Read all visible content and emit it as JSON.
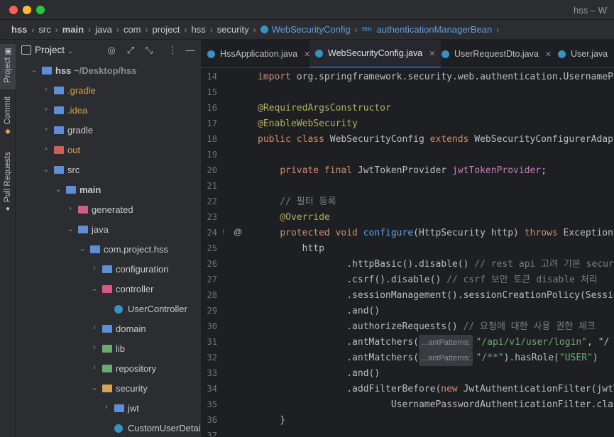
{
  "window": {
    "title": "hss – W"
  },
  "navbar": {
    "crumbs": [
      "hss",
      "src",
      "main",
      "java",
      "com",
      "project",
      "hss",
      "security"
    ],
    "class_crumb": "WebSecurityConfig",
    "method_crumb": "authenticationManagerBean"
  },
  "strip": {
    "project": "Project",
    "commit": "Commit",
    "pull_requests": "Pull Requests"
  },
  "panel": {
    "title": "Project"
  },
  "tree": [
    {
      "label": "hss",
      "sub": "~/Desktop/hss",
      "level": 0,
      "expanded": true,
      "bold": true,
      "icon": "folder-blue"
    },
    {
      "label": ".gradle",
      "level": 1,
      "expanded": false,
      "color": "orange",
      "icon": "folder-gradle"
    },
    {
      "label": ".idea",
      "level": 1,
      "expanded": false,
      "color": "orange",
      "icon": "folder-idea"
    },
    {
      "label": "gradle",
      "level": 1,
      "expanded": false,
      "icon": "folder-gradle"
    },
    {
      "label": "out",
      "level": 1,
      "expanded": false,
      "color": "orange",
      "icon": "folder-red"
    },
    {
      "label": "src",
      "level": 1,
      "expanded": true,
      "icon": "folder-src"
    },
    {
      "label": "main",
      "level": 2,
      "expanded": true,
      "bold": true,
      "icon": "folder-main"
    },
    {
      "label": "generated",
      "level": 3,
      "expanded": false,
      "icon": "folder-generated"
    },
    {
      "label": "java",
      "level": 3,
      "expanded": true,
      "icon": "folder-blue"
    },
    {
      "label": "com.project.hss",
      "level": 4,
      "expanded": true,
      "icon": "folder-package"
    },
    {
      "label": "configuration",
      "level": 5,
      "expanded": false,
      "icon": "folder-package"
    },
    {
      "label": "controller",
      "level": 5,
      "expanded": true,
      "icon": "folder-controller"
    },
    {
      "label": "UserController",
      "level": 6,
      "leaf": true,
      "icon": "class-icon"
    },
    {
      "label": "domain",
      "level": 5,
      "expanded": false,
      "icon": "folder-package"
    },
    {
      "label": "lib",
      "level": 5,
      "expanded": false,
      "icon": "folder-lib"
    },
    {
      "label": "repository",
      "level": 5,
      "expanded": false,
      "icon": "folder-repo"
    },
    {
      "label": "security",
      "level": 5,
      "expanded": true,
      "icon": "folder-security"
    },
    {
      "label": "jwt",
      "level": 6,
      "expanded": false,
      "icon": "folder-package"
    },
    {
      "label": "CustomUserDetailS",
      "level": 6,
      "leaf": true,
      "icon": "class-icon"
    }
  ],
  "tabs": [
    {
      "label": "HssApplication.java",
      "active": false
    },
    {
      "label": "WebSecurityConfig.java",
      "active": true
    },
    {
      "label": "UserRequestDto.java",
      "active": false
    },
    {
      "label": "User.java",
      "active": false
    }
  ],
  "editor": {
    "lines": [
      {
        "n": "14",
        "tokens": [
          [
            "kw",
            "import "
          ],
          [
            "",
            "org.springframework.security.web.authentication.UsernamePassw"
          ]
        ]
      },
      {
        "n": "15",
        "tokens": []
      },
      {
        "n": "16",
        "tokens": [
          [
            "an",
            "@RequiredArgsConstructor"
          ]
        ]
      },
      {
        "n": "17",
        "tokens": [
          [
            "an",
            "@EnableWebSecurity"
          ]
        ]
      },
      {
        "n": "18",
        "tokens": [
          [
            "kw",
            "public class "
          ],
          [
            "",
            "WebSecurityConfig "
          ],
          [
            "kw",
            "extends "
          ],
          [
            "",
            "WebSecurityConfigurerAdapter"
          ]
        ]
      },
      {
        "n": "19",
        "tokens": []
      },
      {
        "n": "20",
        "tokens": [
          [
            "",
            "    "
          ],
          [
            "kw",
            "private final "
          ],
          [
            "",
            "JwtTokenProvider "
          ],
          [
            "fld",
            "jwtTokenProvider"
          ],
          [
            "",
            ";"
          ]
        ]
      },
      {
        "n": "21",
        "tokens": []
      },
      {
        "n": "22",
        "tokens": [
          [
            "cmt",
            "    // 필터 등록"
          ]
        ]
      },
      {
        "n": "23",
        "tokens": [
          [
            "an",
            "    @Override"
          ]
        ]
      },
      {
        "n": "24",
        "tokens": [
          [
            "",
            "    "
          ],
          [
            "kw",
            "protected void "
          ],
          [
            "mth",
            "configure"
          ],
          [
            "",
            "(HttpSecurity http) "
          ],
          [
            "kw",
            "throws "
          ],
          [
            "",
            "Exception {"
          ]
        ]
      },
      {
        "n": "25",
        "tokens": [
          [
            "",
            "        http"
          ]
        ]
      },
      {
        "n": "26",
        "tokens": [
          [
            "",
            "                .httpBasic().disable() "
          ],
          [
            "cmt",
            "// rest api 고려 기본 security"
          ]
        ]
      },
      {
        "n": "27",
        "tokens": [
          [
            "",
            "                .csrf().disable() "
          ],
          [
            "cmt",
            "// csrf 보안 토큰 disable 처리"
          ]
        ]
      },
      {
        "n": "28",
        "tokens": [
          [
            "",
            "                .sessionManagement().sessionCreationPolicy(SessionCr"
          ]
        ]
      },
      {
        "n": "29",
        "tokens": [
          [
            "",
            "                .and()"
          ]
        ]
      },
      {
        "n": "30",
        "tokens": [
          [
            "",
            "                .authorizeRequests() "
          ],
          [
            "cmt",
            "// 요청에 대한 사용 권한 체크"
          ]
        ]
      },
      {
        "n": "31",
        "tokens": [
          [
            "",
            "                .antMatchers("
          ],
          [
            "hint",
            "...antPatterns:"
          ],
          [
            "str",
            "\"/api/v1/user/login\""
          ],
          [
            "",
            ", \"/"
          ]
        ]
      },
      {
        "n": "32",
        "tokens": [
          [
            "",
            "                .antMatchers("
          ],
          [
            "hint",
            "...antPatterns:"
          ],
          [
            "str",
            "\"/**\""
          ],
          [
            "",
            ").hasRole("
          ],
          [
            "str",
            "\"USER\""
          ],
          [
            "",
            ")"
          ]
        ]
      },
      {
        "n": "33",
        "tokens": [
          [
            "",
            "                .and()"
          ]
        ]
      },
      {
        "n": "34",
        "tokens": [
          [
            "",
            "                .addFilterBefore("
          ],
          [
            "kw",
            "new "
          ],
          [
            "",
            "JwtAuthenticationFilter(jwtTo"
          ]
        ]
      },
      {
        "n": "35",
        "tokens": [
          [
            "",
            "                        UsernamePasswordAuthenticationFilter.class"
          ]
        ]
      },
      {
        "n": "36",
        "tokens": [
          [
            "",
            "    }"
          ]
        ]
      },
      {
        "n": "37",
        "tokens": []
      }
    ]
  },
  "colors": {
    "accent": "#3574f0",
    "folder": "#5e8fd6",
    "keyword": "#cf8e6d",
    "annotation": "#b3ae60",
    "string": "#6aab73"
  }
}
